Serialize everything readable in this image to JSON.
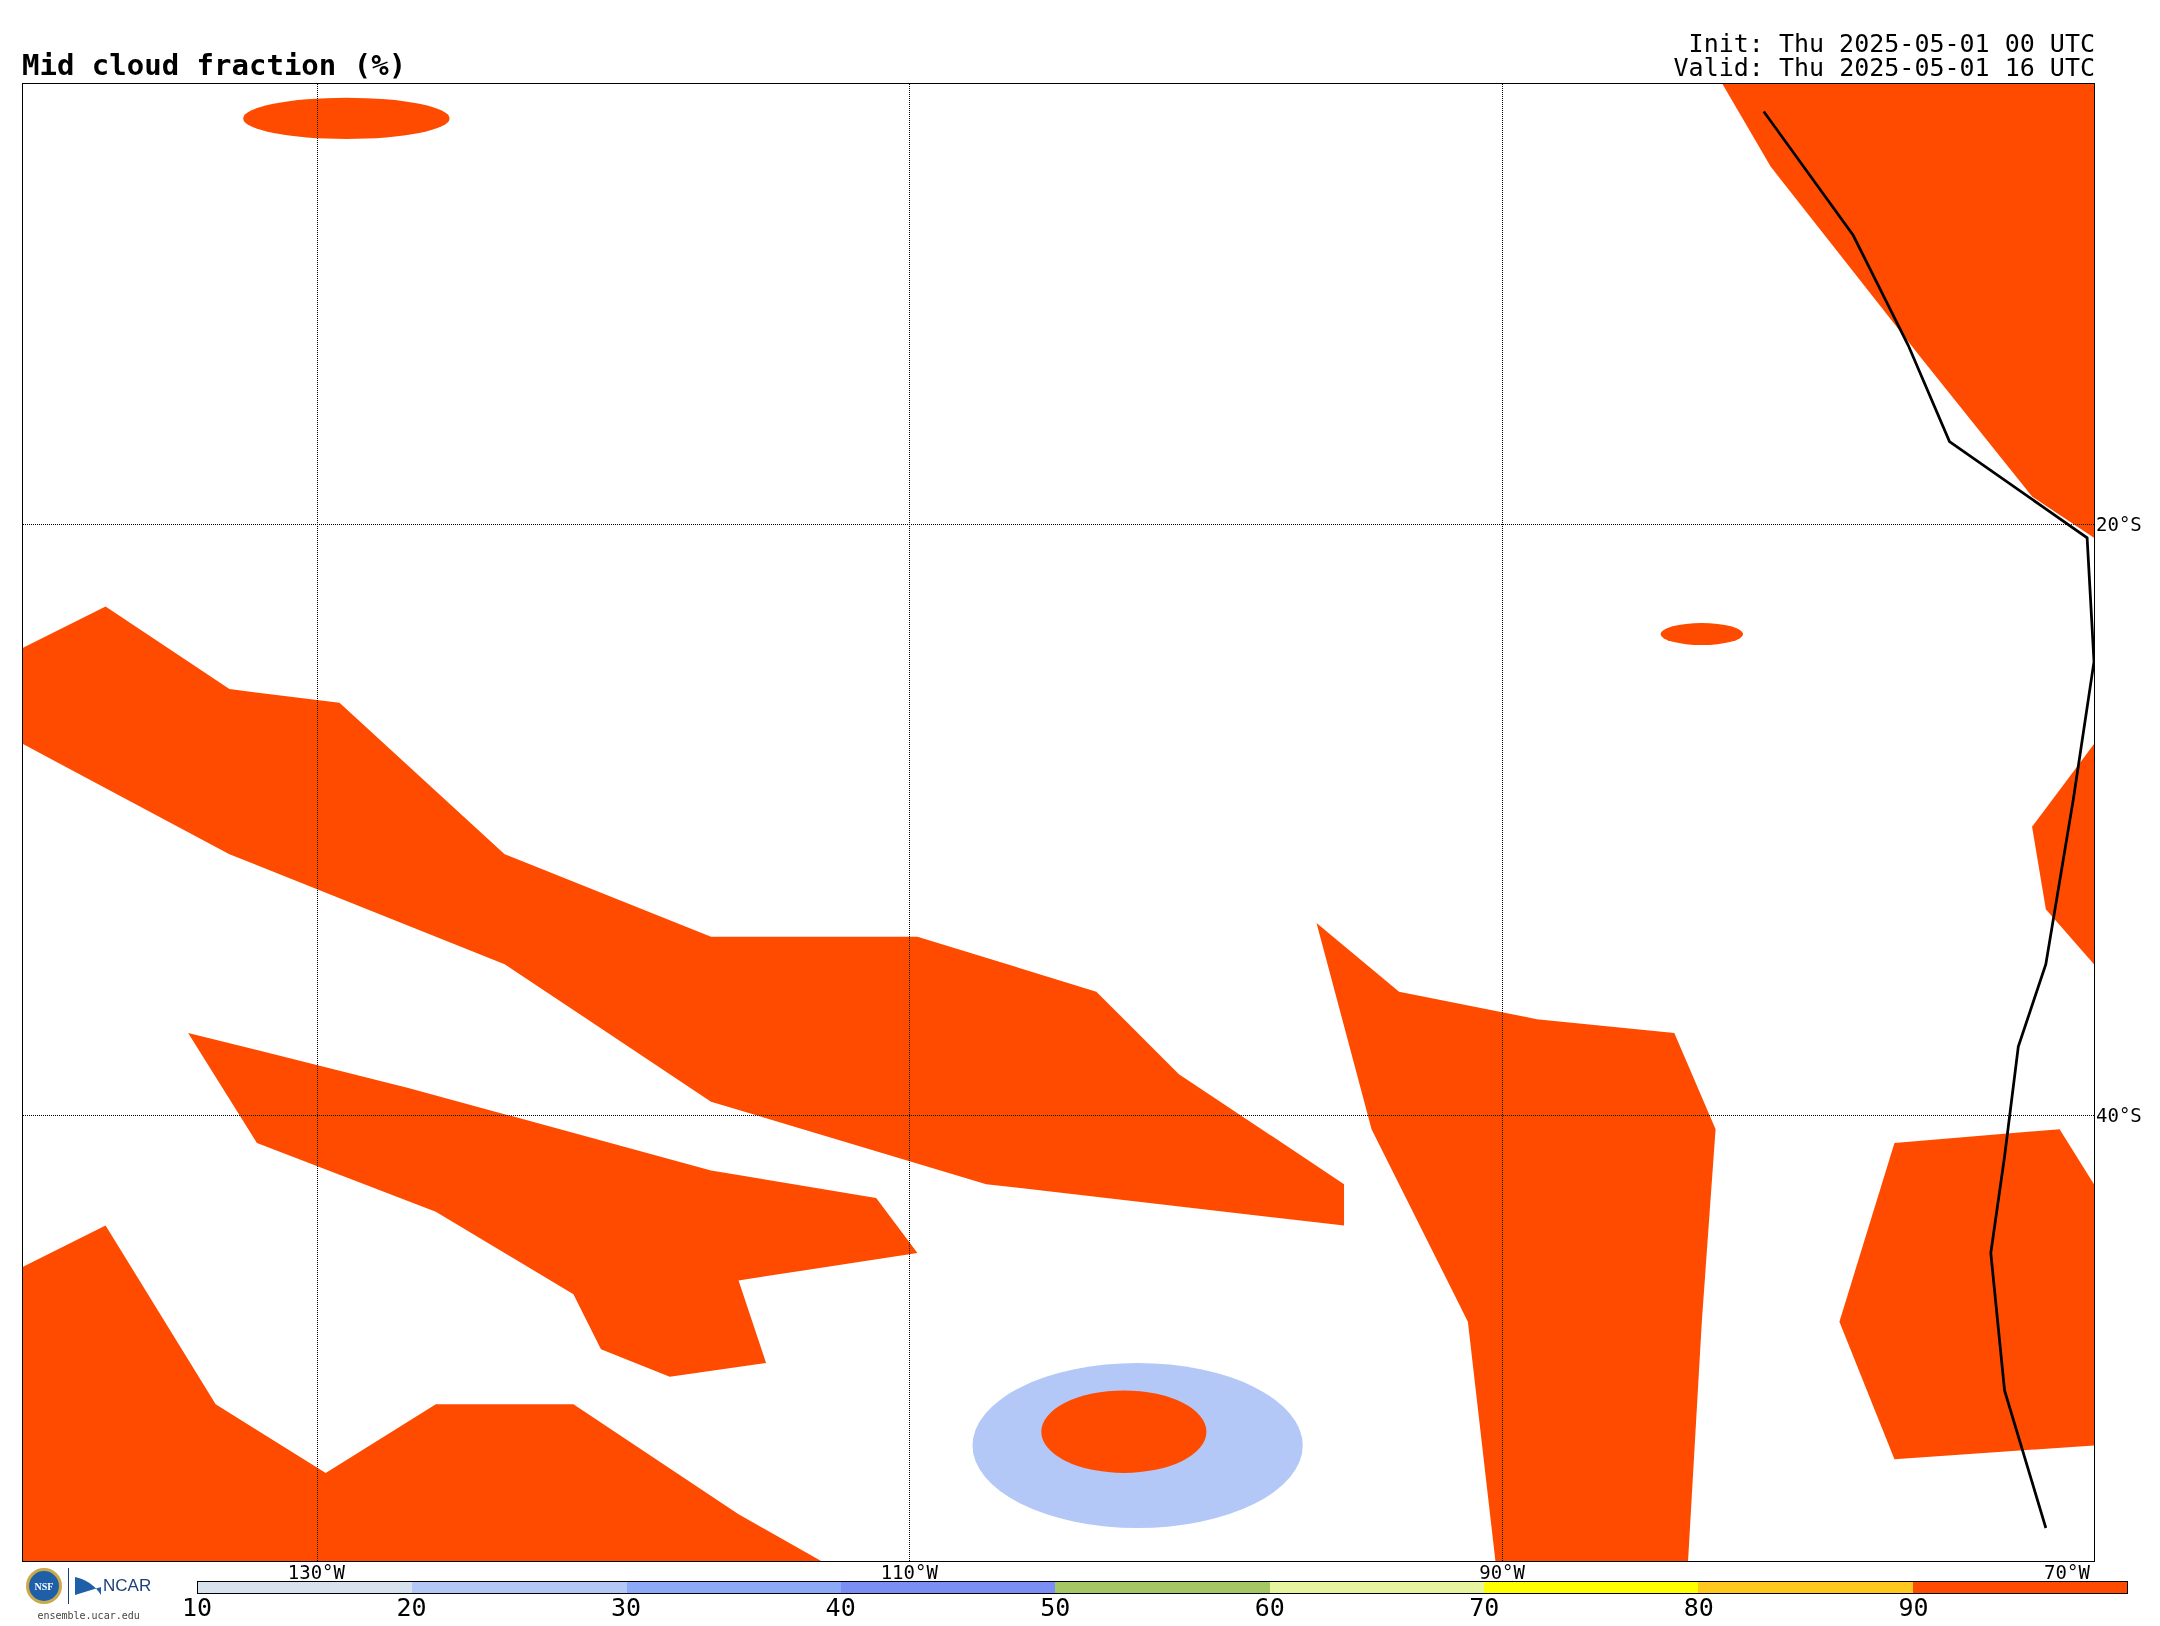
{
  "title": "Mid cloud fraction (%)",
  "init": "Init: Thu 2025-05-01 00 UTC",
  "valid": "Valid: Thu 2025-05-01 16 UTC",
  "map": {
    "lat_labels": [
      "20°S",
      "40°S"
    ],
    "lon_labels": [
      "130°W",
      "110°W",
      "90°W",
      "70°W"
    ]
  },
  "colorbar": {
    "segments": [
      {
        "color": "#d6e2ed"
      },
      {
        "color": "#b4c8f8"
      },
      {
        "color": "#8caaf7"
      },
      {
        "color": "#7a8ef5"
      },
      {
        "color": "#a5c864"
      },
      {
        "color": "#e8f5a0"
      },
      {
        "color": "#ffff00"
      },
      {
        "color": "#ffc81e"
      },
      {
        "color": "#ff4b00"
      }
    ],
    "ticks": [
      "10",
      "20",
      "30",
      "40",
      "50",
      "60",
      "70",
      "80",
      "90"
    ]
  },
  "logos": {
    "nsf": "NSF",
    "ncar": "NCAR",
    "site": "ensemble.ucar.edu"
  }
}
